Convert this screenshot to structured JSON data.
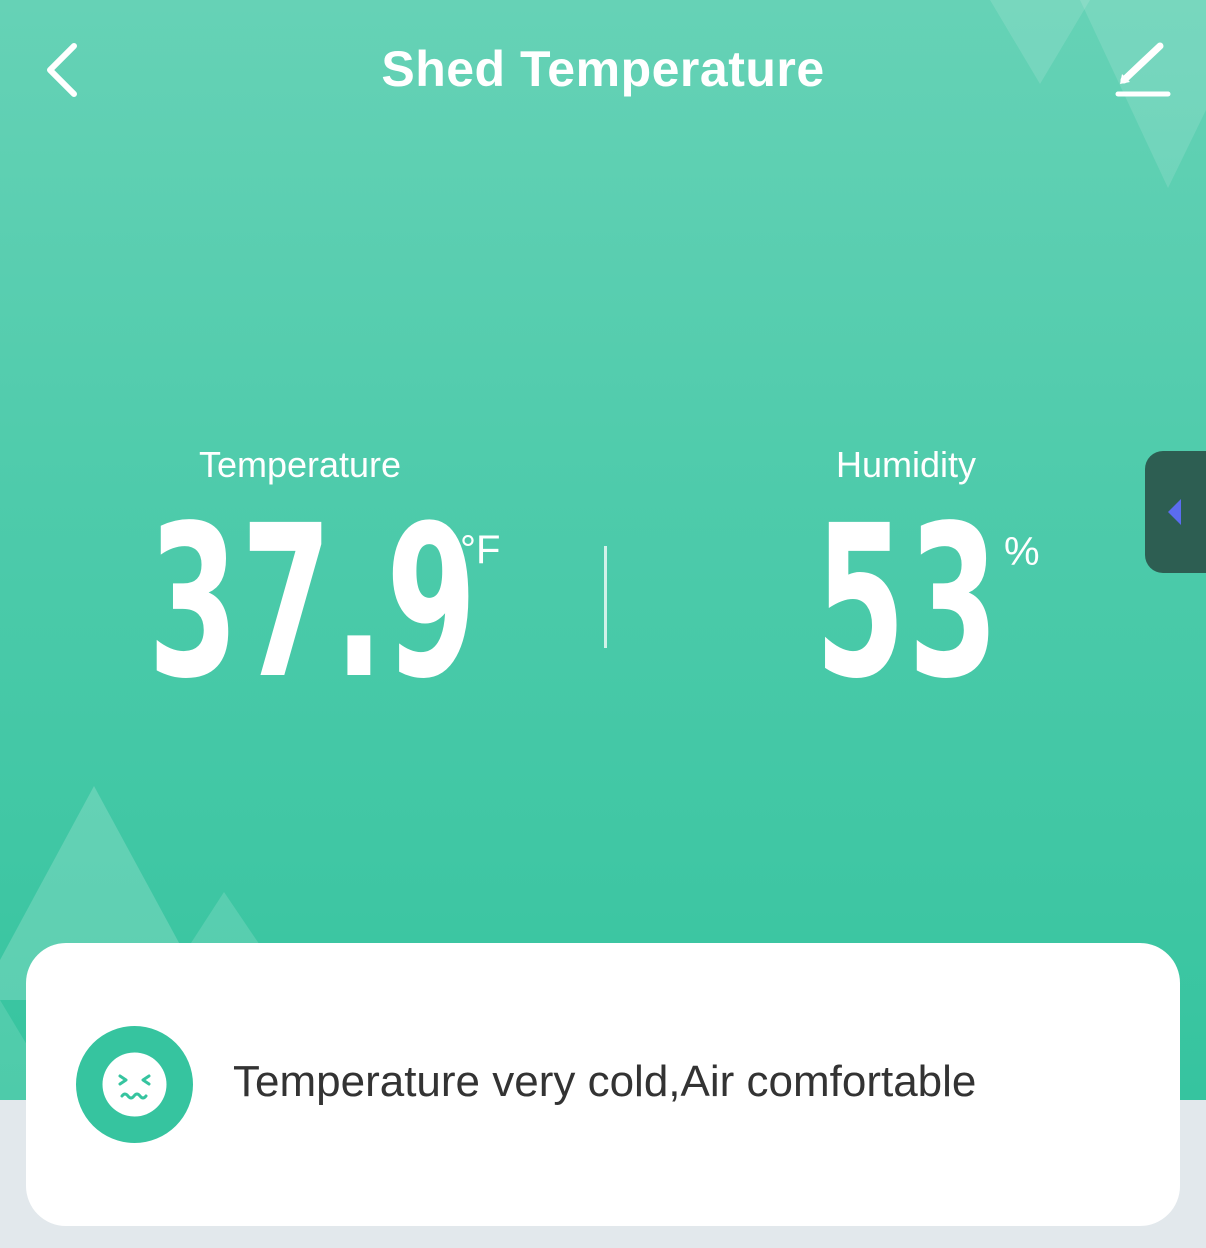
{
  "header": {
    "title": "Shed Temperature",
    "back_icon": "chevron-left-icon",
    "edit_icon": "pencil-icon"
  },
  "readings": {
    "temperature": {
      "label": "Temperature",
      "value": "37.9",
      "unit": "°F"
    },
    "humidity": {
      "label": "Humidity",
      "value": "53",
      "unit": "%"
    }
  },
  "side_tab": {
    "icon": "caret-left-icon",
    "icon_color": "#5b6cf0"
  },
  "status": {
    "icon": "cold-face-icon",
    "text": "Temperature very cold,Air comfortable"
  },
  "colors": {
    "accent": "#36c49f",
    "hero_top": "#66d2b6",
    "hero_bottom": "#36c49f",
    "side_tab": "#2d5e52",
    "background": "#e2e8ec"
  }
}
